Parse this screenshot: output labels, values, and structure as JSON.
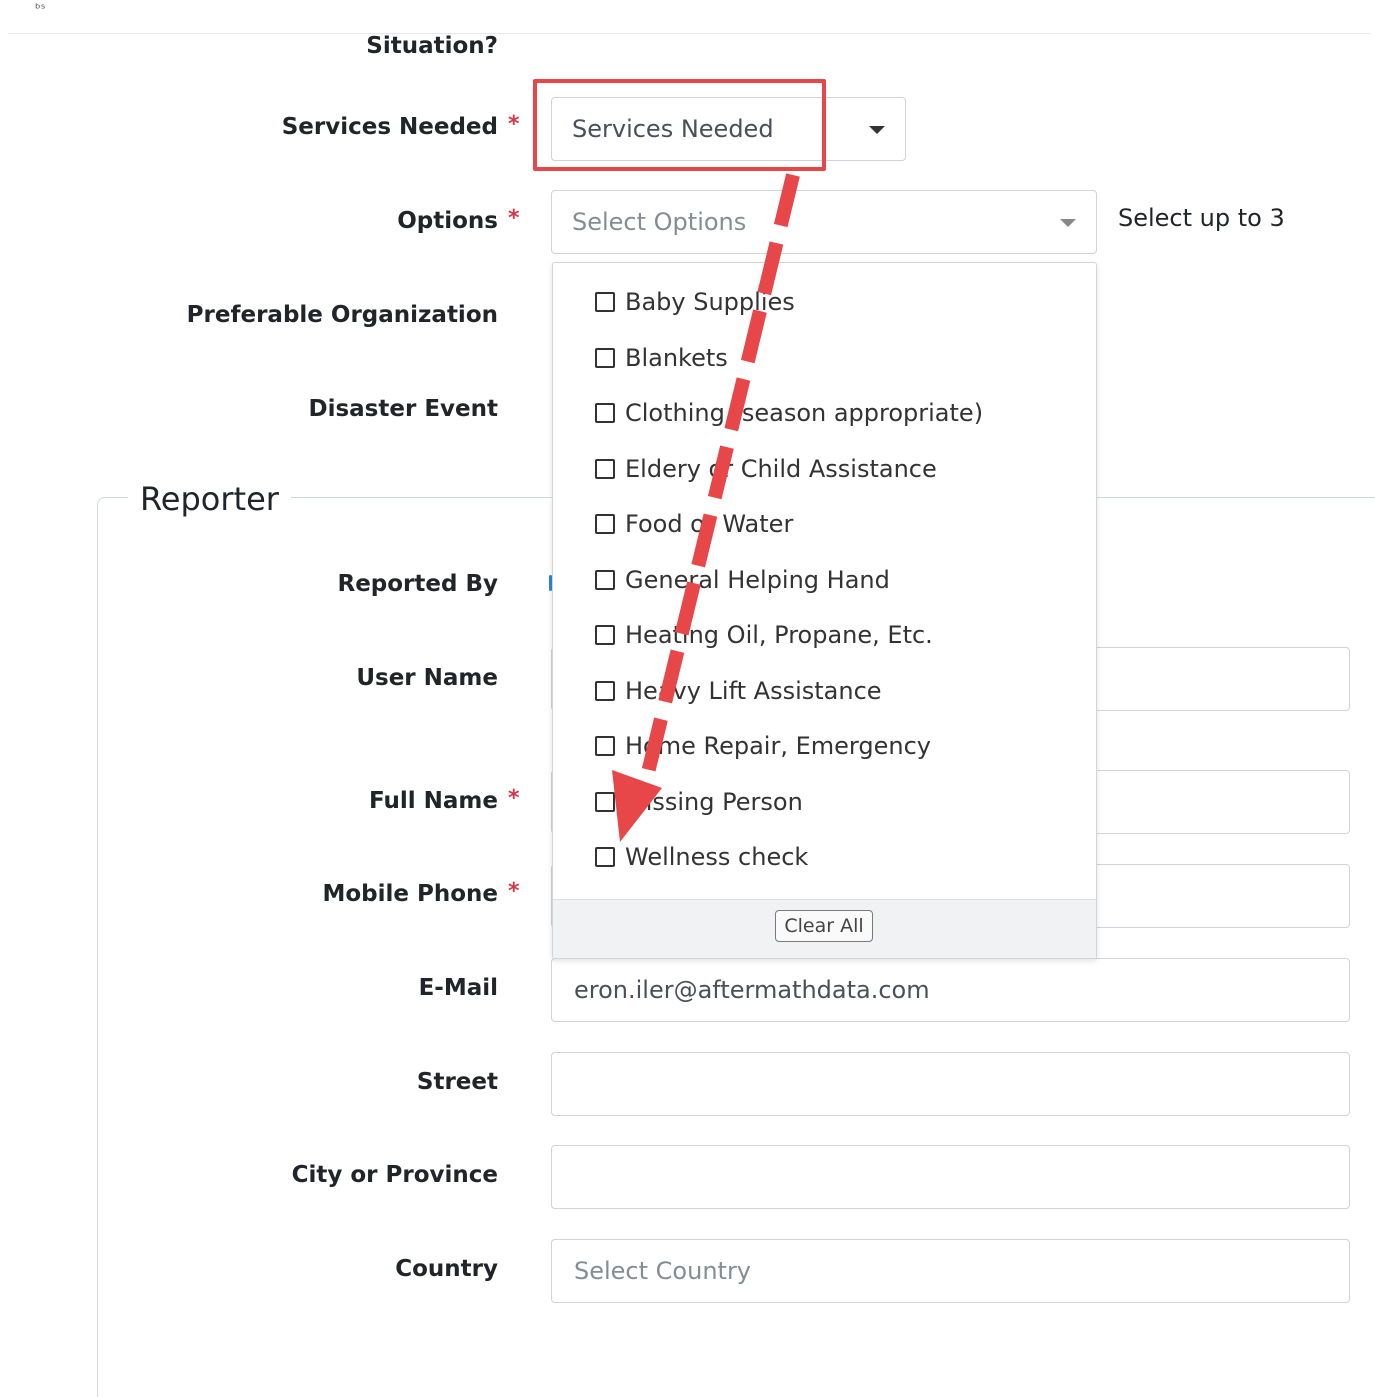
{
  "top": {
    "corner_glyph": "ᵇˢ"
  },
  "fields": {
    "situation_label": "Situation?",
    "services_label": "Services Needed",
    "services_value": "Services Needed",
    "options_label": "Options",
    "options_placeholder": "Select Options",
    "options_hint": "Select up to 3",
    "pref_org_label": "Preferable Organization",
    "disaster_label": "Disaster Event",
    "required_mark": "*"
  },
  "reporter": {
    "legend": "Reporter",
    "reported_by_label": "Reported By",
    "user_name_label": "User Name",
    "full_name_label": "Full Name",
    "mobile_label": "Mobile Phone",
    "email_label": "E-Mail",
    "email_value": "eron.iler@aftermathdata.com",
    "street_label": "Street",
    "city_label": "City or Province",
    "country_label": "Country",
    "country_placeholder": "Select Country"
  },
  "dropdown": {
    "options": [
      "Baby Supplies",
      "Blankets",
      "Clothing (season appropriate)",
      "Eldery or Child Assistance",
      "Food or Water",
      "General Helping Hand",
      "Heating Oil, Propane, Etc.",
      "Heavy Lift Assistance",
      "Home Repair, Emergency",
      "Missing Person",
      "Wellness check"
    ],
    "clear_all": "Clear All"
  },
  "colors": {
    "annotation": "#e8474a",
    "required": "#dc3545",
    "border": "#ced4da"
  }
}
